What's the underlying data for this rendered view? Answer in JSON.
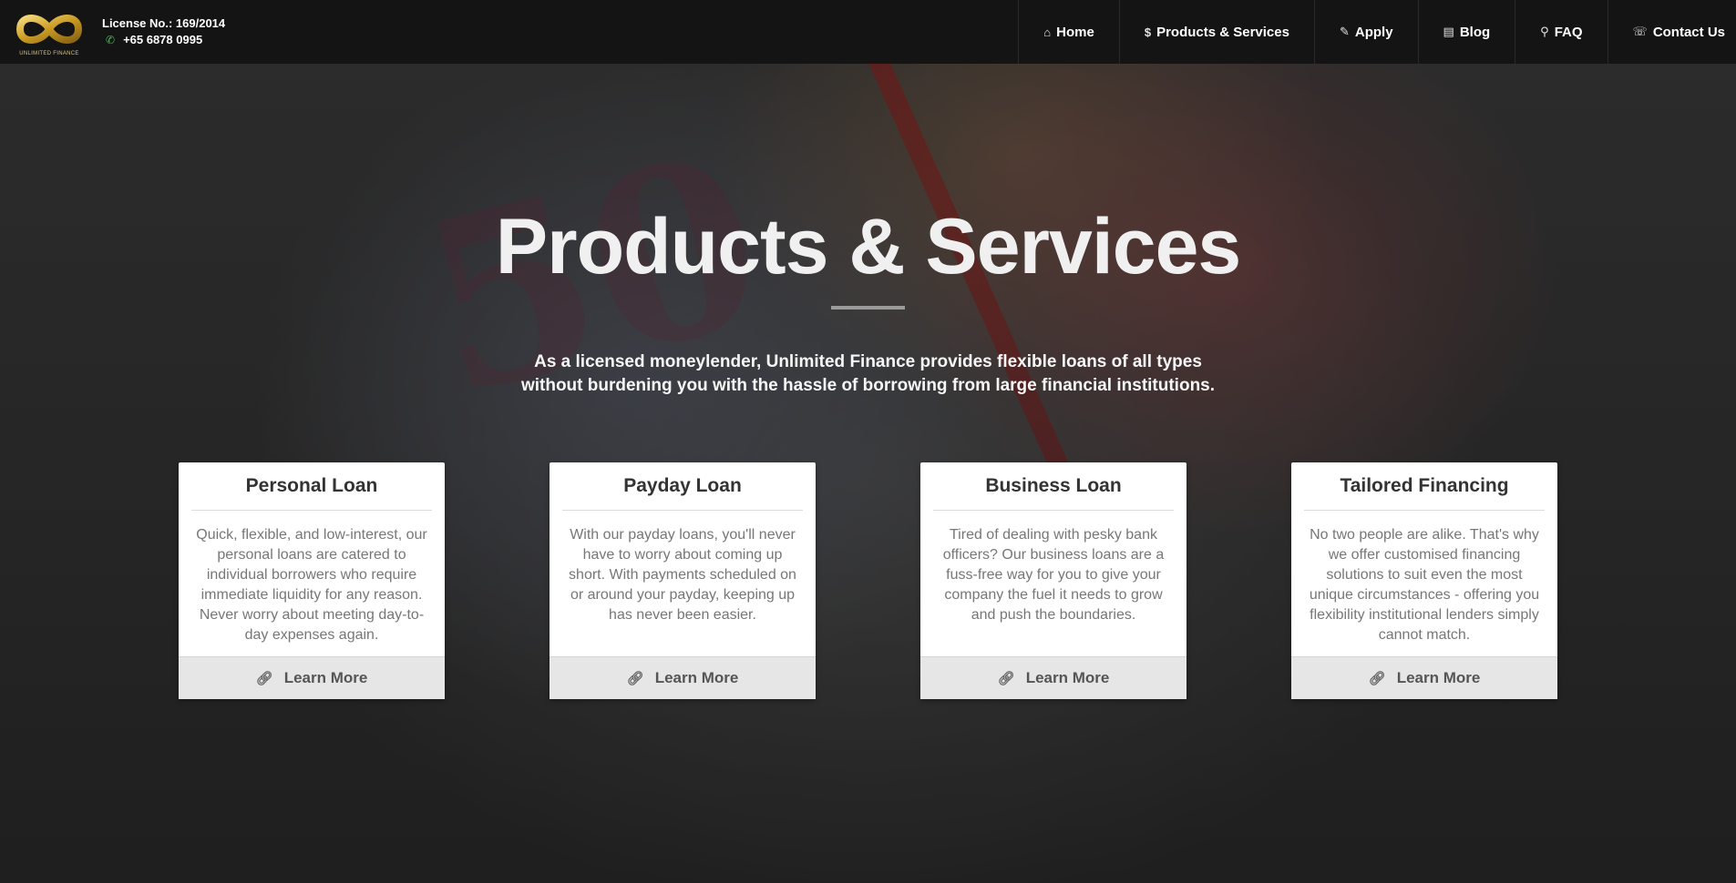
{
  "header": {
    "logo_text": "UNLIMITED FINANCE",
    "license": "License No.: 169/2014",
    "phone": "+65 6878 0995",
    "colors": {
      "bar": "#141414",
      "logo_gold": "#d4a52a",
      "phone_icon": "#3fbf4f"
    }
  },
  "nav": {
    "items": [
      {
        "label": "Home",
        "icon": "home-icon"
      },
      {
        "label": "Products & Services",
        "icon": "dollar-icon"
      },
      {
        "label": "Apply",
        "icon": "edit-icon"
      },
      {
        "label": "Blog",
        "icon": "newspaper-icon"
      },
      {
        "label": "FAQ",
        "icon": "pin-icon"
      },
      {
        "label": "Contact Us",
        "icon": "phone-icon"
      }
    ]
  },
  "hero": {
    "title": "Products & Services",
    "subtitle": "As a licensed moneylender, Unlimited Finance provides flexible loans of all types without burdening you with the hassle of borrowing from large financial institutions."
  },
  "cards": [
    {
      "title": "Personal Loan",
      "body": "Quick, flexible, and low-interest, our personal loans are catered to individual borrowers who require immediate liquidity for any reason. Never worry about meeting day-to-day expenses again.",
      "button": "Learn More"
    },
    {
      "title": "Payday Loan",
      "body": "With our payday loans, you'll never have to worry about coming up short. With payments scheduled on or around your payday, keeping up has never been easier.",
      "button": "Learn More"
    },
    {
      "title": "Business Loan",
      "body": "Tired of dealing with pesky bank officers? Our business loans are a fuss-free way for you to give your company the fuel it needs to grow and push the boundaries.",
      "button": "Learn More"
    },
    {
      "title": "Tailored Financing",
      "body": "No two people are alike. That's why we offer customised financing solutions to suit even the most unique circumstances - offering you flexibility institutional lenders simply cannot match.",
      "button": "Learn More"
    }
  ]
}
